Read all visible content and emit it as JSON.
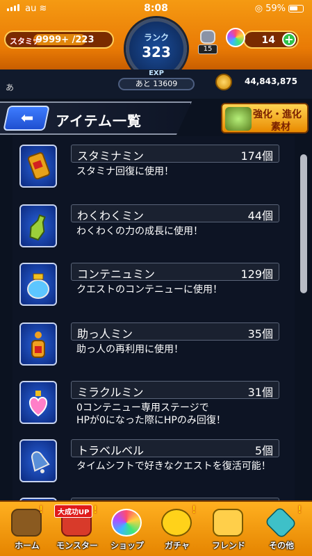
{
  "status_bar": {
    "carrier": "au",
    "time": "8:08",
    "battery": "59%"
  },
  "header": {
    "stamina_label": "スタミナ",
    "stamina_value": "9999+ /223",
    "rank_label": "ランク",
    "rank_value": "323",
    "exp_label": "EXP",
    "exp_remaining": "あと 13609",
    "level_badge": "15",
    "orb_count": "14",
    "a_char": "あ",
    "gold": "44,843,875"
  },
  "title_bar": {
    "title": "アイテム一覧",
    "evo_line1": "強化・進化",
    "evo_line2": "素材"
  },
  "items": [
    {
      "name": "スタミナミン",
      "count": "174個",
      "desc": "スタミナ回復に使用！",
      "icon": "can-icon"
    },
    {
      "name": "わくわくミン",
      "count": "44個",
      "desc": "わくわくの力の成長に使用！",
      "icon": "bottle-icon"
    },
    {
      "name": "コンテニュミン",
      "count": "129個",
      "desc": "クエストのコンテニューに使用！",
      "icon": "jar-icon"
    },
    {
      "name": "助っ人ミン",
      "count": "35個",
      "desc": "助っ人の再利用に使用！",
      "icon": "vial-icon"
    },
    {
      "name": "ミラクルミン",
      "count": "31個",
      "desc": "0コンテニュー専用ステージで\nHPが0になった際にHPのみ回復！",
      "icon": "heart-potion-icon"
    },
    {
      "name": "トラベルベル",
      "count": "5個",
      "desc": "タイムシフトで好きなクエストを復活可能！",
      "icon": "bell-icon"
    }
  ],
  "bottom_nav": {
    "promo_badge": "大成功UP",
    "items": [
      "ホーム",
      "モンスター",
      "ショップ",
      "ガチャ",
      "フレンド",
      "その他"
    ]
  },
  "colors": {
    "header_orange": "#f59a12",
    "nav_orange": "#ffb020",
    "panel_dark": "#0d1424",
    "back_blue": "#3d7cff"
  }
}
